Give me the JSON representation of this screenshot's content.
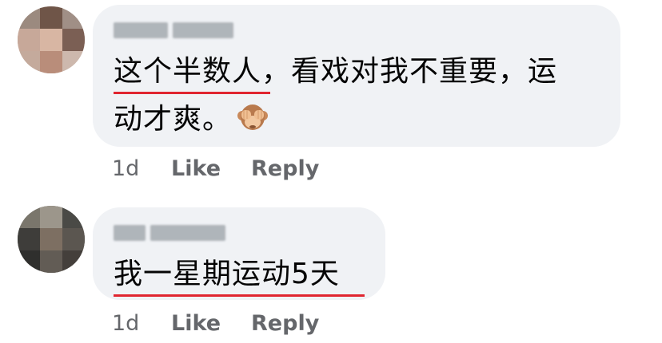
{
  "comments": [
    {
      "text_line1": "这个半数人，看戏对我不重要，运",
      "text_line2": "动才爽。",
      "emoji": "see-no-evil-monkey",
      "time": "1d",
      "like_label": "Like",
      "reply_label": "Reply"
    },
    {
      "text_line1": "我一星期运动5天",
      "time": "1d",
      "like_label": "Like",
      "reply_label": "Reply"
    }
  ],
  "colors": {
    "bubble": "#f0f2f5",
    "underline": "#e0252f",
    "meta_text": "#65676b"
  }
}
